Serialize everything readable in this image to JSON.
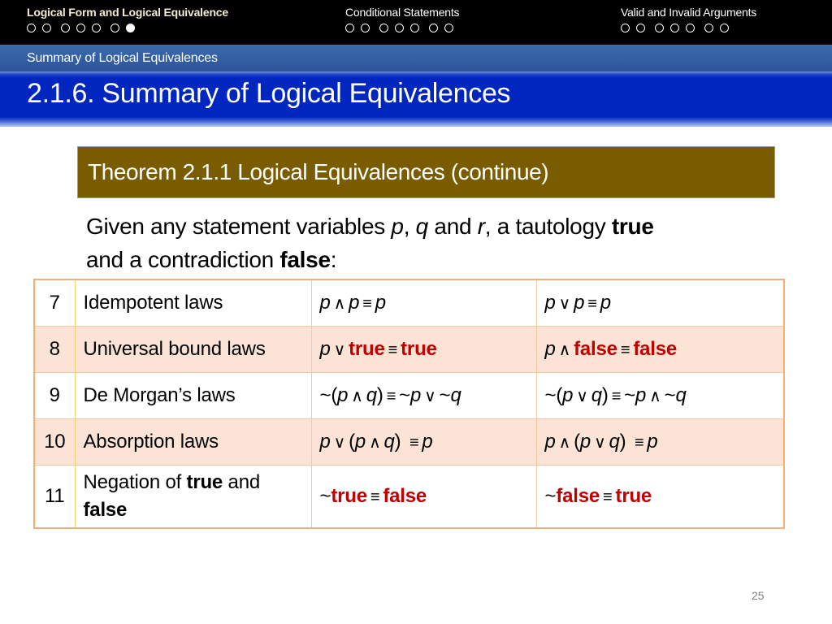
{
  "nav": {
    "sections": [
      {
        "title": "Logical Form and Logical Equivalence",
        "active": true,
        "dots": 7,
        "current_dot": 7
      },
      {
        "title": "Conditional Statements",
        "active": false,
        "dots": 7,
        "current_dot": 0
      },
      {
        "title": "Valid and Invalid Arguments",
        "active": false,
        "dots": 7,
        "current_dot": 0
      }
    ]
  },
  "subsection": "Summary of Logical Equivalences",
  "slide_title": "2.1.6. Summary of Logical Equivalences",
  "theorem": {
    "title": "Theorem 2.1.1 Logical Equivalences (continue)",
    "box_color": "#7a5c00"
  },
  "intro": {
    "t1": "Given any statement variables ",
    "p": "p",
    "c1": ", ",
    "q": "q",
    "t2": " and ",
    "r": "r",
    "t3": ", a tautology ",
    "true": "true",
    "t4": " and a contradiction ",
    "false": "false",
    "t5": ":"
  },
  "symbols": {
    "and": "∧",
    "or": "∨",
    "equiv": "≡",
    "not": "~"
  },
  "colors": {
    "keyword_red": "#c00000",
    "row_shade": "#fbe4d5",
    "table_border": "#f0b178"
  },
  "laws": [
    {
      "num": "7",
      "name": "Idempotent laws",
      "eq1": "p ∧ p ≡ p",
      "eq2": "p ∨ p ≡ p"
    },
    {
      "num": "8",
      "name": "Universal bound laws",
      "eq1": "p ∨ true ≡ true",
      "eq2": "p ∧ false ≡ false"
    },
    {
      "num": "9",
      "name": "De Morgan’s laws",
      "eq1": "~(p ∧ q) ≡ ~p ∨ ~q",
      "eq2": "~(p ∨ q) ≡ ~p ∧ ~q"
    },
    {
      "num": "10",
      "name": "Absorption laws",
      "eq1": "p ∨ (p ∧ q)  ≡ p",
      "eq2": "p ∧ (p ∨ q)  ≡ p"
    },
    {
      "num": "11",
      "name_parts": {
        "a": "Negation of ",
        "b": "true",
        "c": " and ",
        "d": "false"
      },
      "eq1": "~true ≡ false",
      "eq2": "~false ≡ true"
    }
  ],
  "tokens": {
    "p": "p",
    "q": "q",
    "true": "true",
    "false": "false",
    "lp": "(",
    "rp": ")",
    "not": "~"
  },
  "page_number": "25"
}
